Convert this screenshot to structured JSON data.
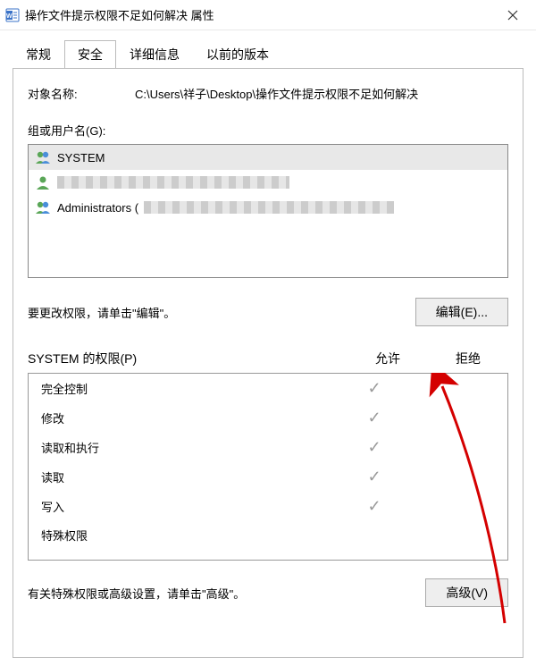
{
  "window": {
    "title": "操作文件提示权限不足如何解决 属性"
  },
  "tabs": {
    "general": "常规",
    "security": "安全",
    "details": "详细信息",
    "previous": "以前的版本"
  },
  "panel": {
    "object_label": "对象名称:",
    "object_path": "C:\\Users\\祥子\\Desktop\\操作文件提示权限不足如何解决",
    "groups_label": "组或用户名(G):",
    "users": {
      "system": "SYSTEM",
      "admins_prefix": "Administrators ("
    },
    "edit_hint": "要更改权限，请单击\"编辑\"。",
    "edit_button": "编辑(E)...",
    "perm_header_label": "SYSTEM 的权限(P)",
    "perm_allow": "允许",
    "perm_deny": "拒绝",
    "perms": {
      "full": "完全控制",
      "modify": "修改",
      "readexec": "读取和执行",
      "read": "读取",
      "write": "写入",
      "special": "特殊权限"
    },
    "adv_hint": "有关特殊权限或高级设置，请单击\"高级\"。",
    "adv_button": "高级(V)"
  }
}
